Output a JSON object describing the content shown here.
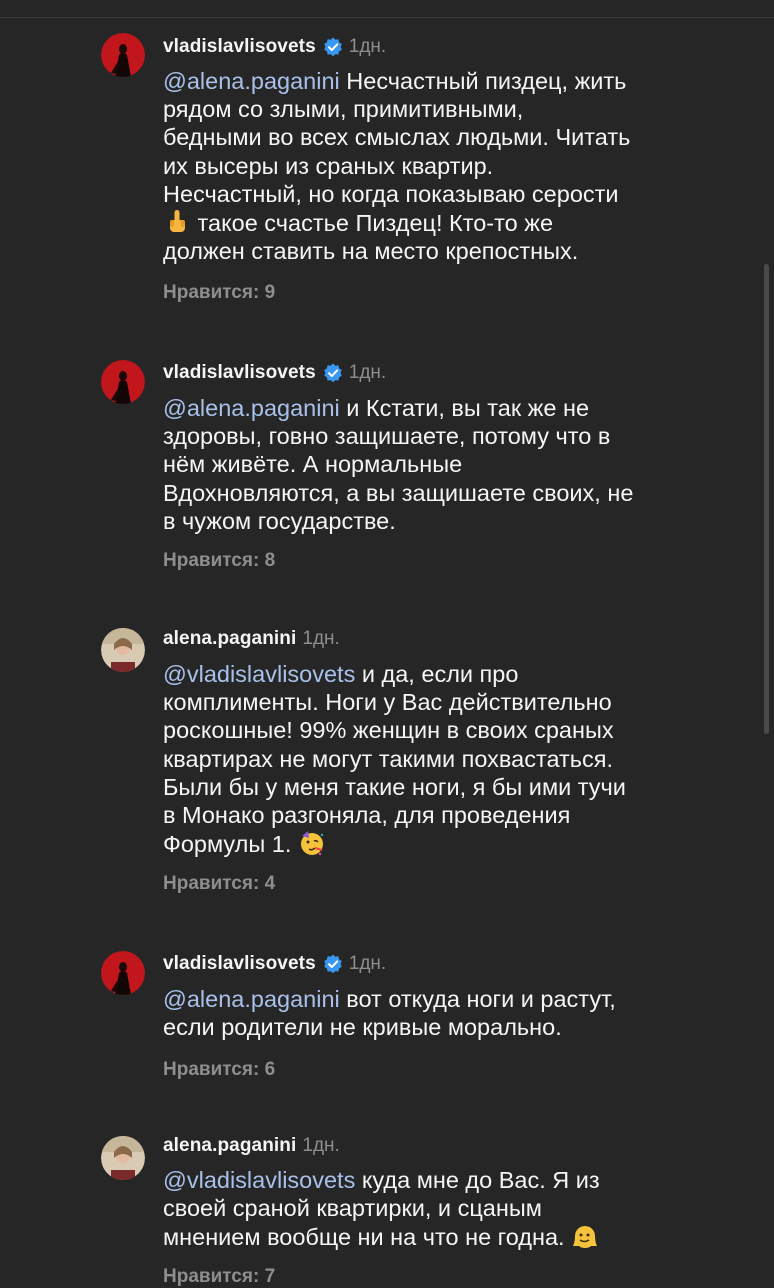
{
  "colors": {
    "background": "#262626",
    "text": "#f5f5f5",
    "muted": "#8e8e8e",
    "mention": "#a9c1ea",
    "verified": "#3897f0"
  },
  "comments": [
    {
      "username": "vladislavlisovets",
      "verified": true,
      "time": "1дн.",
      "mention": "@alena.paganini",
      "text_before_emoji": " Несчастный пиздец, жить\nрядом со злыми, примитивными,\nбедными во всех смыслах людьми. Читать\nих высеры из сраных квартир.\nНесчастный, но когда показываю серости\n",
      "emoji": "middle-finger-emoji",
      "text_after_emoji": "  такое счастье Пиздец!  Кто-то же\nдолжен ставить на место крепостных.",
      "likes": "Нравится: 9"
    },
    {
      "username": "vladislavlisovets",
      "verified": true,
      "time": "1дн.",
      "mention": "@alena.paganini",
      "text": " и Кстати, вы так же не\nздоровы, говно защишаете, потому что в\nнём живёте. А нормальные\nВдохновляются, а вы защишаете своих, не\nв чужом государстве.",
      "likes": "Нравится: 8"
    },
    {
      "username": "alena.paganini",
      "verified": false,
      "time": "1дн.",
      "mention": "@vladislavlisovets",
      "text_before_emoji": " и да, если про\nкомплименты. Ноги у Вас действительно\nроскошные! 99% женщин в своих сраных\nквартирах не могут такими похвастаться.\nБыли бы у меня такие ноги, я бы ими тучи\nв Монако разгоняла, для проведения\nФормулы 1. ",
      "emoji": "partying-face-emoji",
      "likes": "Нравится: 4"
    },
    {
      "username": "vladislavlisovets",
      "verified": true,
      "time": "1дн.",
      "mention": "@alena.paganini",
      "text": " вот откуда ноги и растут,\nесли родители не кривые морально.",
      "likes": "Нравится: 6"
    },
    {
      "username": "alena.paganini",
      "verified": false,
      "time": "1дн.",
      "mention": "@vladislavlisovets",
      "text_before_emoji": " куда мне до Вас. Я из\nсвоей сраной квартирки, и сцаным\nмнением вообще ни на что не годна. ",
      "emoji": "melting-face-emoji",
      "likes": "Нравится: 7"
    }
  ]
}
